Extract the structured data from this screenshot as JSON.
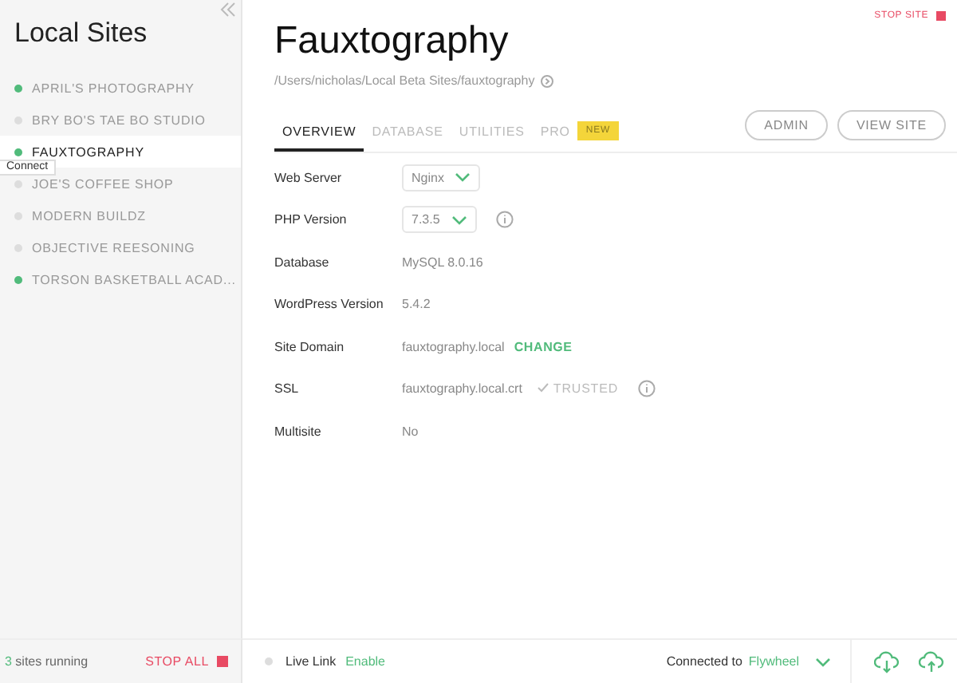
{
  "sidebar": {
    "title": "Local Sites",
    "sites": [
      {
        "name": "APRIL'S PHOTOGRAPHY",
        "running": true,
        "selected": false
      },
      {
        "name": "BRY BO'S TAE BO STUDIO",
        "running": false,
        "selected": false
      },
      {
        "name": "FAUXTOGRAPHY",
        "running": true,
        "selected": true
      },
      {
        "name": "JOE'S COFFEE SHOP",
        "running": false,
        "selected": false
      },
      {
        "name": "MODERN BUILDZ",
        "running": false,
        "selected": false
      },
      {
        "name": "OBJECTIVE REESONING",
        "running": false,
        "selected": false
      },
      {
        "name": "TORSON BASKETBALL ACAD...",
        "running": true,
        "selected": false
      }
    ],
    "tooltip": "Connect",
    "running_count": "3",
    "running_label": "sites running",
    "stop_all": "STOP ALL"
  },
  "site": {
    "title": "Fauxtography",
    "path": "/Users/nicholas/Local Beta Sites/fauxtography",
    "stop_site": "STOP SITE",
    "tabs": [
      {
        "label": "OVERVIEW",
        "selected": true
      },
      {
        "label": "DATABASE",
        "selected": false
      },
      {
        "label": "UTILITIES",
        "selected": false
      },
      {
        "label": "PRO",
        "selected": false,
        "badge": "NEW"
      }
    ],
    "buttons": [
      "ADMIN",
      "VIEW SITE"
    ],
    "rows": [
      {
        "label": "Web Server",
        "kind": "select",
        "value": "Nginx",
        "info": false
      },
      {
        "label": "PHP Version",
        "kind": "select",
        "value": "7.3.5",
        "info": true
      },
      {
        "label": "Database",
        "kind": "text",
        "value": "MySQL 8.0.16",
        "info": false
      },
      {
        "label": "WordPress Version",
        "kind": "text",
        "value": "5.4.2",
        "info": false
      },
      {
        "label": "Site Domain",
        "kind": "text",
        "value": "fauxtography.local",
        "action": "CHANGE",
        "info": false
      },
      {
        "label": "SSL",
        "kind": "ssl",
        "value": "fauxtography.local.crt",
        "status": "TRUSTED",
        "info": true
      },
      {
        "label": "Multisite",
        "kind": "text",
        "value": "No",
        "info": false
      }
    ]
  },
  "footer": {
    "live_link": {
      "enabled": false,
      "label": "Live Link",
      "action": "Enable"
    },
    "connected_label": "Connected to",
    "provider": "Flywheel"
  }
}
